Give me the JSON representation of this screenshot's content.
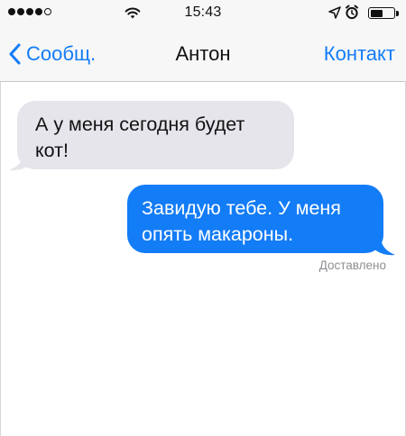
{
  "status_bar": {
    "time": "15:43",
    "signal_bars_filled": 4,
    "signal_bars_total": 5,
    "battery_level": 0.55,
    "icons": [
      "signal-dots",
      "wifi-icon",
      "location-arrow-icon",
      "alarm-icon",
      "battery-icon"
    ]
  },
  "nav": {
    "back_label": "Сообщ.",
    "title": "Антон",
    "contact_label": "Контакт"
  },
  "messages": [
    {
      "direction": "incoming",
      "text": "А у меня сегодня будет кот!"
    },
    {
      "direction": "outgoing",
      "text": "Завидую тебе. У меня опять макароны."
    }
  ],
  "delivery_status": "Доставлено",
  "colors": {
    "accent": "#137cf7",
    "incoming_bubble": "#e6e5eb",
    "outgoing_bubble": "#137cf7",
    "bar_background": "#f7f7f7",
    "status_gray": "#8e8e93"
  }
}
